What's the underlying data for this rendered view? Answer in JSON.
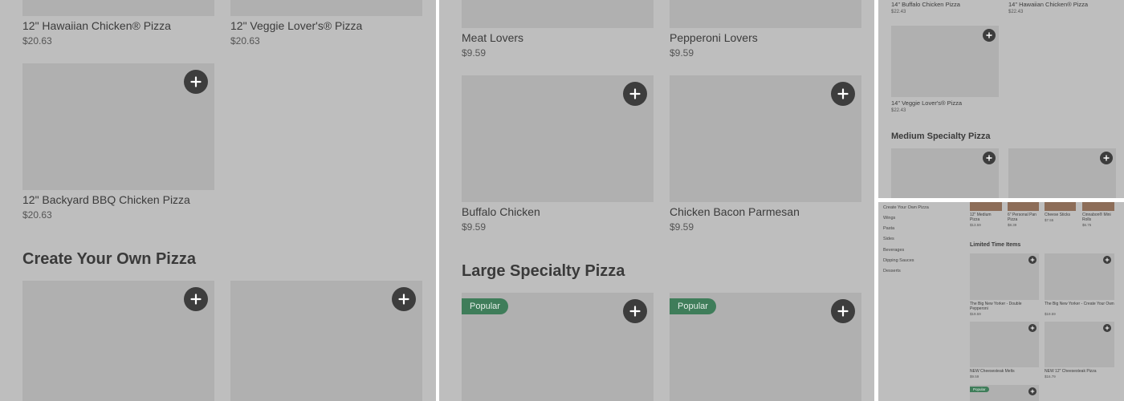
{
  "panel1": {
    "items": [
      {
        "name": "12\" Hawaiian Chicken® Pizza",
        "price": "$20.63"
      },
      {
        "name": "12\" Veggie Lover's® Pizza",
        "price": "$20.63"
      },
      {
        "name": "12\" Backyard BBQ Chicken Pizza",
        "price": "$20.63"
      }
    ],
    "section_heading": "Create Your Own Pizza"
  },
  "panel2": {
    "items": [
      {
        "name": "Meat Lovers",
        "price": "$9.59"
      },
      {
        "name": "Pepperoni Lovers",
        "price": "$9.59"
      },
      {
        "name": "Buffalo Chicken",
        "price": "$9.59"
      },
      {
        "name": "Chicken Bacon Parmesan",
        "price": "$9.59"
      }
    ],
    "section_heading": "Large Specialty Pizza",
    "badges": [
      "Popular",
      "Popular"
    ]
  },
  "panel3": {
    "items": [
      {
        "name": "14\" Buffalo Chicken Pizza",
        "price": "$22.43"
      },
      {
        "name": "14\" Hawaiian Chicken® Pizza",
        "price": "$22.43"
      },
      {
        "name": "14\" Veggie Lover's® Pizza",
        "price": "$22.43"
      }
    ],
    "section_heading": "Medium Specialty Pizza"
  },
  "panel4": {
    "nav": [
      "Create Your Own Pizza",
      "Wings",
      "Pasta",
      "Sides",
      "Beverages",
      "Dipping Sauces",
      "Desserts"
    ],
    "top_items": [
      {
        "name": "12\" Medium Pizza",
        "price": "$13.59"
      },
      {
        "name": "6\" Personal Pan Pizza",
        "price": "$8.39"
      },
      {
        "name": "Cheese Sticks",
        "price": "$7.55"
      },
      {
        "name": "Cinnabon® Mini Rolls",
        "price": "$6.75"
      }
    ],
    "section_heading": "Limited Time Items",
    "items": [
      {
        "name": "The Big New Yorker - Double Pepperoni",
        "price": "$19.59"
      },
      {
        "name": "The Big New Yorker - Create Your Own",
        "price": "$19.59"
      },
      {
        "name": "NEW Cheesesteak Melts",
        "price": "$9.59"
      },
      {
        "name": "NEW 12\" Cheesesteak Pizza",
        "price": "$16.79"
      }
    ],
    "badge": "Popular"
  },
  "colors": {
    "overlay": "#bebebe",
    "image_placeholder": "#b0b0b0",
    "add_button": "#3d3d3d",
    "popular_badge": "#3f7d5a"
  }
}
